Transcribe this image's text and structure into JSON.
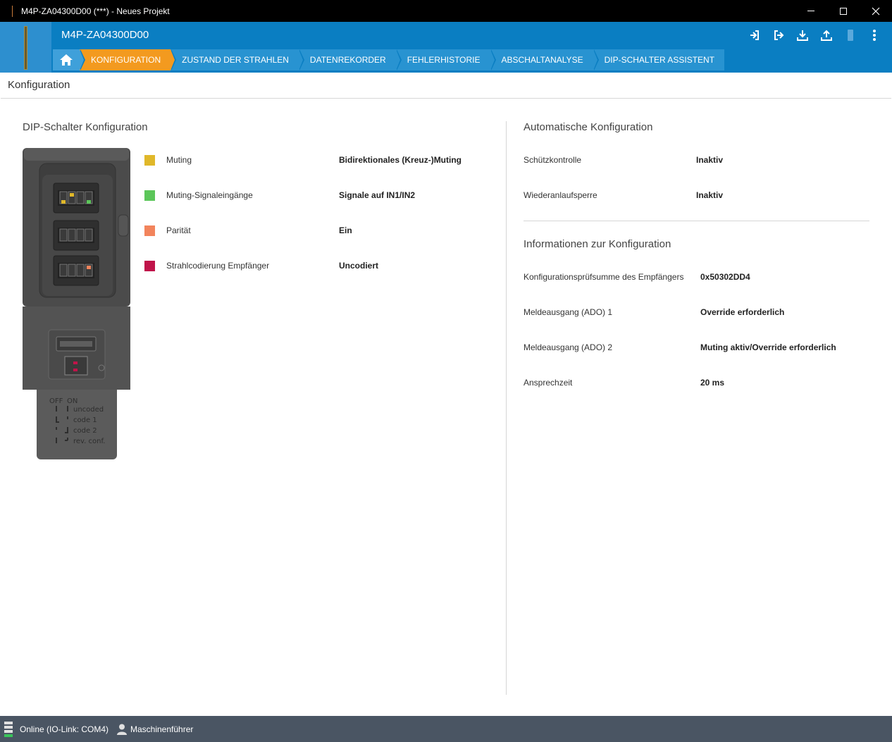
{
  "window": {
    "title": "M4P-ZA04300D00 (***) - Neues Projekt"
  },
  "header": {
    "device_name": "M4P-ZA04300D00",
    "toolbar_icons": [
      "login-icon",
      "logout-icon",
      "download-icon",
      "upload-icon",
      "battery-icon",
      "more-vertical-icon"
    ]
  },
  "tabs": [
    {
      "label": "KONFIGURATION",
      "active": true
    },
    {
      "label": "ZUSTAND DER STRAHLEN",
      "active": false
    },
    {
      "label": "DATENREKORDER",
      "active": false
    },
    {
      "label": "FEHLERHISTORIE",
      "active": false
    },
    {
      "label": "ABSCHALTANALYSE",
      "active": false
    },
    {
      "label": "DIP-SCHALTER ASSISTENT",
      "active": false
    }
  ],
  "page": {
    "title": "Konfiguration"
  },
  "dip": {
    "section_title": "DIP-Schalter Konfiguration",
    "rows": [
      {
        "label": "Muting",
        "value": "Bidirektionales (Kreuz-)Muting",
        "color": "#e0b82a"
      },
      {
        "label": "Muting-Signaleingänge",
        "value": "Signale auf IN1/IN2",
        "color": "#5cc65a"
      },
      {
        "label": "Parität",
        "value": "Ein",
        "color": "#f2845c"
      },
      {
        "label": "Strahlcodierung Empfänger",
        "value": "Uncodiert",
        "color": "#c0144a"
      }
    ],
    "device_legend": {
      "off": "OFF",
      "on": "ON",
      "codes": [
        "uncoded",
        "code 1",
        "code 2",
        "rev. conf."
      ]
    }
  },
  "auto": {
    "section_title": "Automatische Konfiguration",
    "rows": [
      {
        "label": "Schützkontrolle",
        "value": "Inaktiv"
      },
      {
        "label": "Wiederanlaufsperre",
        "value": "Inaktiv"
      }
    ]
  },
  "info": {
    "section_title": "Informationen zur Konfiguration",
    "rows": [
      {
        "label": "Konfigurationsprüfsumme des Empfängers",
        "value": "0x50302DD4"
      },
      {
        "label": "Meldeausgang (ADO) 1",
        "value": "Override erforderlich"
      },
      {
        "label": "Meldeausgang (ADO) 2",
        "value": "Muting aktiv/Override erforderlich"
      },
      {
        "label": "Ansprechzeit",
        "value": "20 ms"
      }
    ]
  },
  "status": {
    "connection": "Online (IO-Link: COM4)",
    "user": "Maschinenführer"
  }
}
